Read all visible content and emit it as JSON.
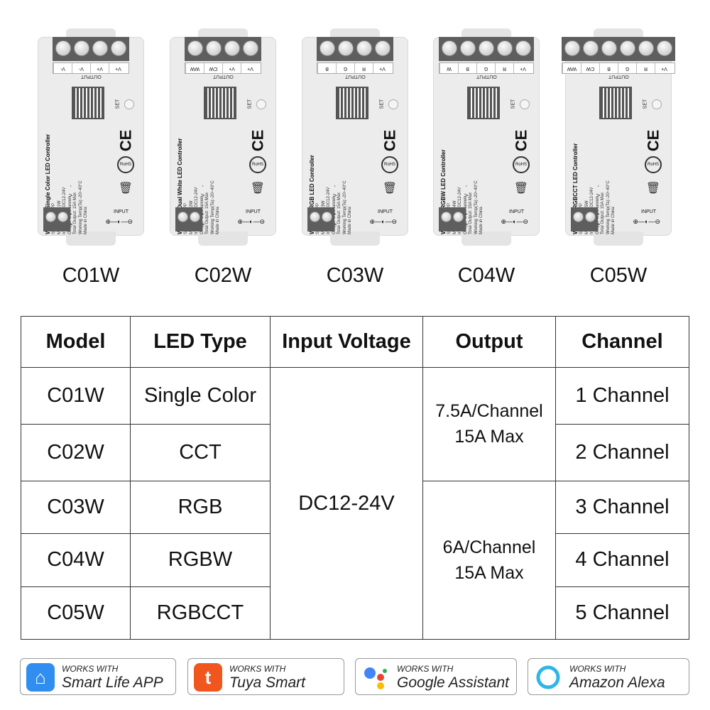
{
  "devices": [
    {
      "model": "C01W",
      "title": "WiFi&BT Single Color LED Controller",
      "outputs": [
        "V+",
        "V+",
        "V-",
        "V-"
      ]
    },
    {
      "model": "C02W",
      "title": "WiFi&BT Dual White LED Controller",
      "outputs": [
        "V+",
        "V+",
        "CW",
        "WW"
      ]
    },
    {
      "model": "C03W",
      "title": "WiFi&BT RGB LED Controller",
      "outputs": [
        "V+",
        "R",
        "G",
        "B"
      ]
    },
    {
      "model": "C04W",
      "title": "WiFi&BT RGBW LED Controller",
      "outputs": [
        "V+",
        "R",
        "G",
        "B",
        "W"
      ]
    },
    {
      "model": "C05W",
      "title": "WiFi&BT RGBCCT LED Controller",
      "outputs": [
        "V+",
        "R",
        "G",
        "B",
        "CW",
        "WW"
      ]
    }
  ],
  "device_common": {
    "scan": "Scan install APP",
    "voltage": "Input Voltage: DC12-24V",
    "output": "Output: 6A/Channel",
    "total": "Total Output: 15A Max",
    "temp": "Working Temp(Ta):-20~40°C",
    "made": "Made in China",
    "model_prefix": "Model No.:",
    "output_label": "OUTPUT",
    "input_label": "INPUT",
    "set_label": "SET",
    "ce": "CE",
    "rohs": "RoHS",
    "input_terms": "V+ V-"
  },
  "table": {
    "headers": [
      "Model",
      "LED Type",
      "Input Voltage",
      "Output",
      "Channel"
    ],
    "rows": [
      {
        "model": "C01W",
        "type": "Single Color",
        "channel": "1 Channel"
      },
      {
        "model": "C02W",
        "type": "CCT",
        "channel": "2 Channel"
      },
      {
        "model": "C03W",
        "type": "RGB",
        "channel": "3 Channel"
      },
      {
        "model": "C04W",
        "type": "RGBW",
        "channel": "4 Channel"
      },
      {
        "model": "C05W",
        "type": "RGBCCT",
        "channel": "5 Channel"
      }
    ],
    "voltage": "DC12-24V",
    "output_a": [
      "7.5A/Channel",
      "15A Max"
    ],
    "output_b": [
      "6A/Channel",
      "15A Max"
    ]
  },
  "badges": [
    {
      "works": "WORKS WITH",
      "name": "Smart  Life APP",
      "icon": "smart-life-icon",
      "color": "#2f8ef0"
    },
    {
      "works": "WORKS WITH",
      "name": "Tuya Smart",
      "icon": "tuya-icon",
      "color": "#f0561e"
    },
    {
      "works": "WORKS WITH",
      "name": "Google Assistant",
      "icon": "google-assistant-icon",
      "color": "#4285f4"
    },
    {
      "works": "WORKS WITH",
      "name": "Amazon Alexa",
      "icon": "alexa-icon",
      "color": "#2fb6e8"
    }
  ]
}
